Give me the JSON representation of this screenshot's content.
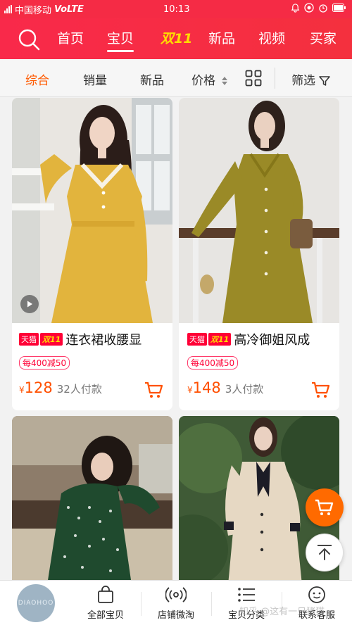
{
  "status": {
    "carrier": "中国移动",
    "network": "VoLTE",
    "time": "10:13"
  },
  "nav": {
    "tabs": [
      "首页",
      "宝贝",
      "双11",
      "新品",
      "视频",
      "买家"
    ],
    "active_index": 1
  },
  "sort": {
    "items": [
      "综合",
      "销量",
      "新品",
      "价格"
    ],
    "active": "综合",
    "filter_label": "筛选"
  },
  "products": [
    {
      "badge_tmall": "天猫",
      "badge_event": "双11",
      "title": "连衣裙收腰显",
      "promo": "每400减50",
      "currency": "¥",
      "price": "128",
      "paid": "32人付款",
      "has_video": true
    },
    {
      "badge_tmall": "天猫",
      "badge_event": "双11",
      "title": "高冷御姐风成",
      "promo": "每400减50",
      "currency": "¥",
      "price": "148",
      "paid": "3人付款",
      "has_video": false
    }
  ],
  "bottom": {
    "logo_text": "DIAOHOO",
    "items": [
      "全部宝贝",
      "店铺微淘",
      "宝贝分类",
      "联系客服"
    ]
  },
  "watermark": "知乎 @这有一只猪猫",
  "colors": {
    "brand_red": "#f52b45",
    "accent_orange": "#ff5000",
    "tmall_red": "#ff0036"
  }
}
